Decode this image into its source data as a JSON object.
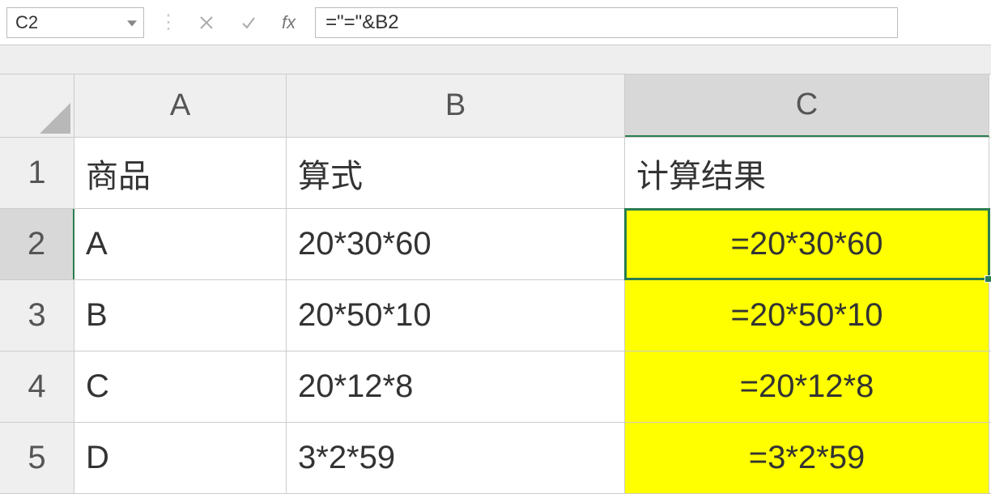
{
  "nameBox": "C2",
  "formulaBar": "=\"=\"&B2",
  "fxLabel": "fx",
  "columns": [
    "A",
    "B",
    "C"
  ],
  "rowNumbers": [
    "1",
    "2",
    "3",
    "4",
    "5"
  ],
  "headers": {
    "A": "商品",
    "B": "算式",
    "C": "计算结果"
  },
  "rows": [
    {
      "A": "A",
      "B": "20*30*60",
      "C": "=20*30*60"
    },
    {
      "A": "B",
      "B": "20*50*10",
      "C": "=20*50*10"
    },
    {
      "A": "C",
      "B": "20*12*8",
      "C": "=20*12*8"
    },
    {
      "A": "D",
      "B": "3*2*59",
      "C": "=3*2*59"
    }
  ],
  "selectedCell": "C2"
}
